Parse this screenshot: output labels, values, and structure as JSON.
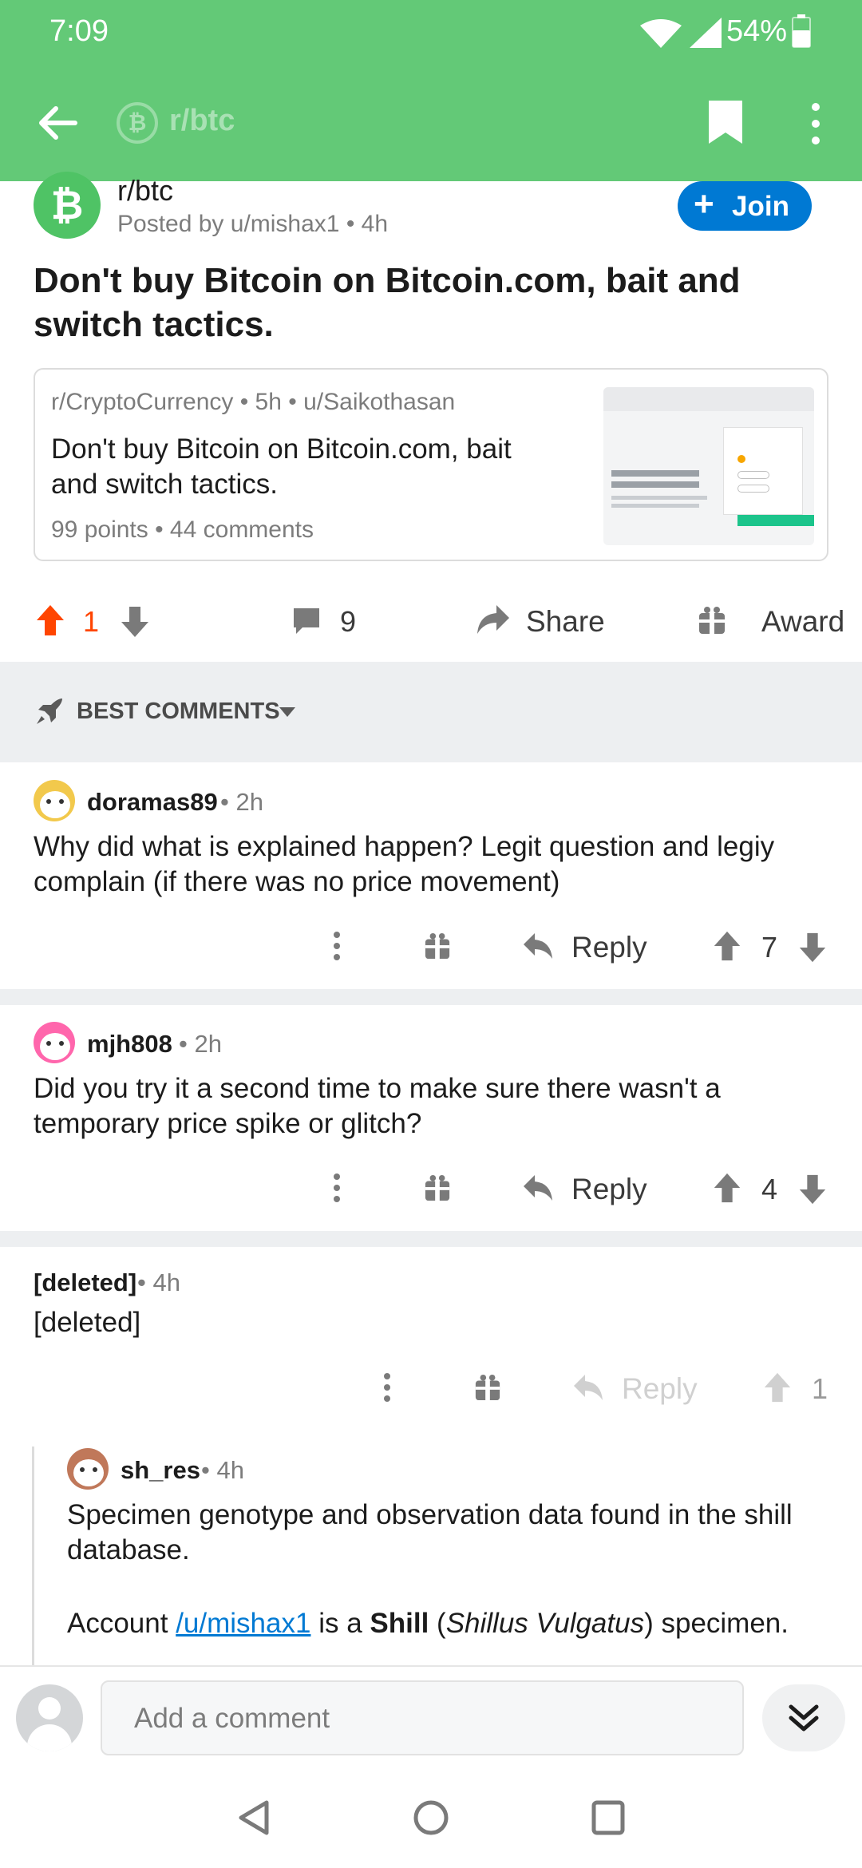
{
  "status": {
    "time": "7:09",
    "battery": "54%"
  },
  "appbar": {
    "subreddit": "r/btc"
  },
  "post": {
    "subreddit": "r/btc",
    "posted_by": "Posted by u/mishax1 • 4h",
    "join_label": "Join",
    "title": "Don't buy Bitcoin on Bitcoin.com, bait and switch tactics.",
    "crosspost": {
      "meta": "r/CryptoCurrency • 5h • u/Saikothasan",
      "title": "Don't buy Bitcoin on Bitcoin.com, bait and switch tactics.",
      "stats": "99 points • 44 comments"
    },
    "votes": "1",
    "comments_count": "9",
    "share_label": "Share",
    "award_label": "Award"
  },
  "sort": {
    "label": "BEST COMMENTS"
  },
  "comments": [
    {
      "author": "doramas89",
      "age": "• 2h",
      "body": "Why did what is explained happen? Legit question and legiy complain (if there was no price movement)",
      "reply_label": "Reply",
      "score": "7"
    },
    {
      "author": "mjh808",
      "age": "• 2h",
      "body": "Did you try it a second time to make sure there wasn't a temporary price spike or glitch?",
      "reply_label": "Reply",
      "score": "4"
    },
    {
      "author": "[deleted]",
      "age": "• 4h",
      "body": "[deleted]",
      "reply_label": "Reply",
      "score": "1"
    }
  ],
  "reply": {
    "author": "sh_res",
    "age": "• 4h",
    "line1": "Specimen genotype and observation data found in the shill database.",
    "account_prefix": "Account",
    "account_link": "/u/mishax1",
    "is_a": "is a",
    "shill": "Shill",
    "open_paren": "(",
    "species": "Shillus Vulgatus",
    "close_text": ") specimen."
  },
  "composer": {
    "placeholder": "Add a comment"
  },
  "colors": {
    "brand_green": "#63c977",
    "upvote": "#ff4500",
    "join_blue": "#0079d3",
    "link": "#0079d3"
  }
}
